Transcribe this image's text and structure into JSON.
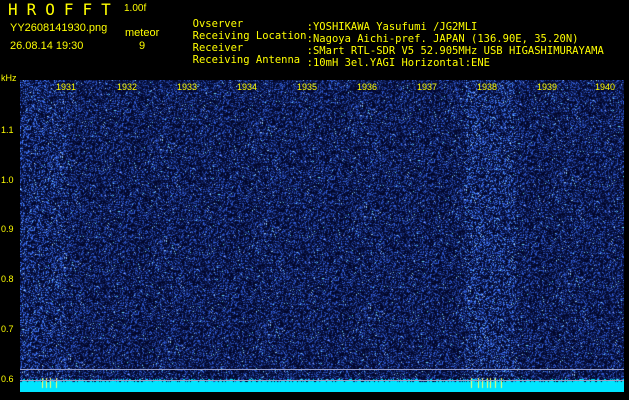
{
  "header": {
    "logo": "HROFFT",
    "version": "1.00f",
    "filename": "YY2608141930.png",
    "datetime": "26.08.14 19:30",
    "meteor_label": "meteor",
    "meteor_count": "9"
  },
  "station_info": [
    {
      "key": "Ovserver",
      "value": ":YOSHIKAWA Yasufumi /JG2MLI"
    },
    {
      "key": "Receiving Location",
      "value": ":Nagoya Aichi-pref. JAPAN (136.90E, 35.20N)"
    },
    {
      "key": "Receiver",
      "value": ":SMart RTL-SDR V5 52.905MHz USB HIGASHIMURAYAMA"
    },
    {
      "key": "Receiving Antenna",
      "value": ":10mH 3el.YAGI Horizontal:ENE"
    }
  ],
  "plot": {
    "y_unit": "kHz",
    "y_ticks": [
      "1.1",
      "1.0",
      "0.9",
      "0.8",
      "0.7",
      "0.6"
    ],
    "x_ticks": [
      "1931",
      "1932",
      "1933",
      "1934",
      "1935",
      "1936",
      "1937",
      "1938",
      "1939",
      "1940"
    ],
    "colors": {
      "text": "#ffff00",
      "background": "#000000",
      "noise_base": "#020230",
      "signal_cyan": "#00e5ff",
      "marker_line": "#9aa0c8"
    }
  }
}
